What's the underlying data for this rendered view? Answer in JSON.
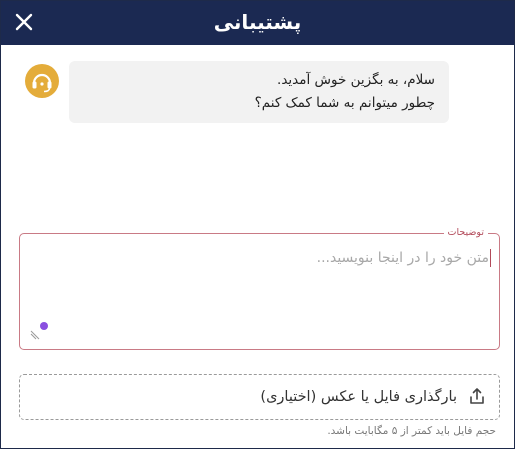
{
  "header": {
    "title": "پشتیبانی",
    "close_icon": "close-icon"
  },
  "chat": {
    "avatar_icon": "headset-support-icon",
    "message_lines": [
      "سلام، به بگزین خوش آمدید.",
      "چطور میتوانم به شما کمک کنم؟"
    ]
  },
  "description_field": {
    "label": "توضیحات",
    "placeholder": "متن خود را در اینجا بنویسید...",
    "value": ""
  },
  "upload": {
    "icon": "upload-icon",
    "label": "بارگذاری فایل یا عکس (اختیاری)",
    "hint": "حجم فایل باید کمتر از ۵ مگابایت باشد."
  },
  "colors": {
    "header_bg": "#1b2952",
    "avatar_bg": "#e4ac3a",
    "field_border": "#c97a85",
    "field_label": "#b24a5a",
    "bubble_bg": "#f2f2f2"
  }
}
